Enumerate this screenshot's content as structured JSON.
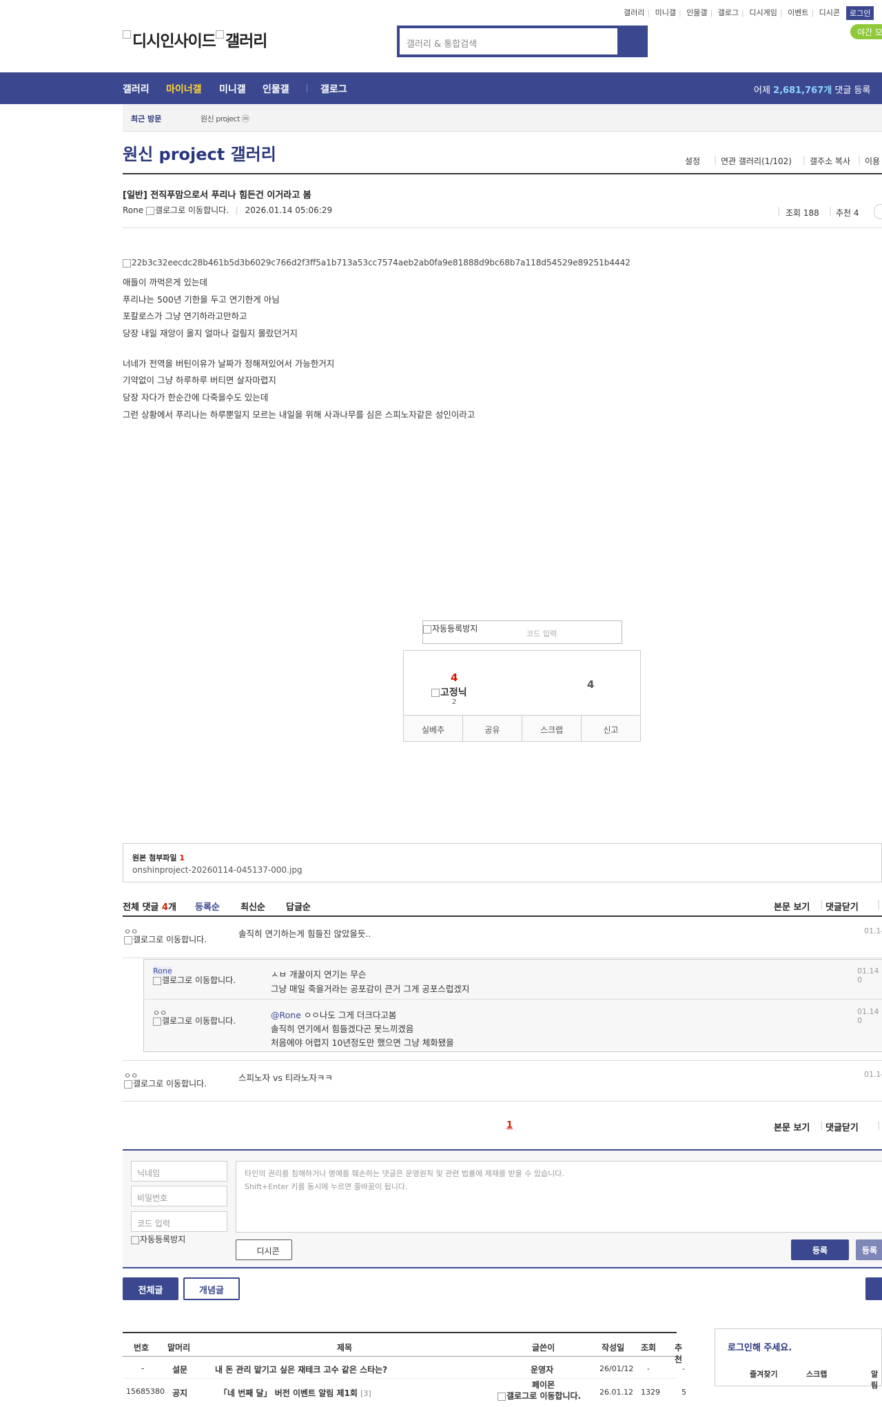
{
  "top_nav": {
    "items": [
      "갤러리",
      "미니갤",
      "인물갤",
      "갤로그",
      "디시게임",
      "이벤트",
      "디시콘"
    ],
    "login": "로그인",
    "night": "야간 모"
  },
  "header": {
    "logo_a": "디시인사이드",
    "logo_b": "갤러리",
    "search_placeholder": "갤러리 & 통합검색"
  },
  "main_nav": {
    "items": [
      "갤러리",
      "마이너갤",
      "미니갤",
      "인물갤",
      "갤로그"
    ],
    "stats_prefix": "어제",
    "stats_count": "2,681,767개",
    "stats_suffix": "댓글 등록"
  },
  "sub_nav": {
    "recent": "최근 방문",
    "gallery": "원신 project ⓜ"
  },
  "gallery": {
    "title": "원신 project 갤러리",
    "tools": [
      "설정",
      "연관 갤러리(1/102)",
      "갤주소 복사",
      "이용"
    ]
  },
  "post": {
    "title": "[일반] 전직푸맘으로서 푸리나 힘든건 이거라고 봄",
    "author": "Rone",
    "author_icon_alt": "갤로그로 이동합니다.",
    "date": "2026.01.14 05:06:29",
    "views": "조회 188",
    "recommend": "추천 4",
    "image_alt": "22b3c32eecdc28b461b5d3b6029c766d2f3ff5a1b713a53cc7574aeb2ab0fa9e81888d9bc68b7a118d54529e89251b4442",
    "lines": [
      "애들이 까먹은게 있는데",
      "푸리나는 500년 기한을 두고 연기한게 아님",
      "포칼로스가 그냥 연기하라고만하고",
      "당장 내일 재앙이 올지 얼마나 걸릴지 몰랐던거지"
    ],
    "lines2": [
      "너네가 전역을 버틴이유가 날짜가 정해져있어서 가능한거지",
      "기약없이 그냥 하루하루 버티면 살자마렵지",
      "당장 자다가 한순간에 다죽을수도 있는데",
      "그런 상황에서 푸리나는 하루뿐일지 모르는 내일을 위해 사과나무를 심은 스피노자같은 성인이라고"
    ]
  },
  "captcha": {
    "img_alt": "자동등록방지",
    "placeholder": "코드 입력"
  },
  "vote": {
    "up": "4",
    "fixed_alt": "고정닉",
    "fixed_count": "2",
    "down": "4",
    "buttons": [
      "실베추",
      "공유",
      "스크랩",
      "신고"
    ]
  },
  "attachment": {
    "label": "원본 첨부파일",
    "count": "1",
    "file": "onshinproject-20260114-045137-000.jpg"
  },
  "comments_header": {
    "all": "전체 댓글",
    "count": "4",
    "unit": "개",
    "sort": [
      "등록순",
      "최신순",
      "답글순"
    ],
    "view_body": "본문 보기",
    "close": "댓글닫기"
  },
  "comments": [
    {
      "nick": "ㅇㅇ",
      "icon": "갤로그로 이동합니다.",
      "text": "솔직히 연기하는게 힘들진 않았을듯..",
      "date": "01.14"
    },
    {
      "nick": "Rone",
      "icon": "갤로그로 이동합니다.",
      "text": "ㅅㅂ 개꿀이지 연기는 무슨",
      "text2": "그냥 매일 죽을거라는 공포감이 큰거 그게 공포스럽겠지",
      "date": "01.14 0"
    },
    {
      "nick": "ㅇㅇ",
      "icon": "갤로그로 이동합니다.",
      "mention": "@Rone",
      "text": "ㅇㅇ나도 그게 더크다고봄",
      "text2": "솔직히 연기에서 힘들겠다곤 못느끼겠음",
      "text3": "처음에야 어렵지 10년정도만 했으면 그냥 체화됐을",
      "date": "01.14 0"
    },
    {
      "nick": "ㅇㅇ",
      "icon": "갤로그로 이동합니다.",
      "text": "스피노자 vs 티라노자ㅋㅋ",
      "date": "01.14"
    }
  ],
  "pagination": {
    "current": "1"
  },
  "write": {
    "nick_ph": "닉네임",
    "pw_ph": "비밀번호",
    "code_ph": "코드 입력",
    "captcha_alt": "자동등록방지",
    "notice": "타인의 권리를 침해하거나 명예를 훼손하는 댓글은 운영원칙 및 관련 법률에 제재를 받을 수 있습니다.",
    "notice2": "Shift+Enter 키를 동시에 누르면 줄바꿈이 됩니다.",
    "dccon": "디시콘",
    "submit": "등록",
    "submit2": "등록"
  },
  "list_tabs": {
    "all": "전체글",
    "concept": "개념글"
  },
  "list": {
    "headers": [
      "번호",
      "말머리",
      "제목",
      "글쓴이",
      "작성일",
      "조회",
      "추천"
    ],
    "rows": [
      {
        "no": "-",
        "head": "설문",
        "title": "내 돈 관리 맡기고 싶은 재테크 고수 같은 스타는?",
        "writer": "운영자",
        "date": "26/01/12",
        "views": "-",
        "rec": "-"
      },
      {
        "no": "15685380",
        "head": "공지",
        "title": "「네 번째 달」 버전 이벤트 알림 제1회",
        "reply": "[3]",
        "writer": "페이몬",
        "writer_icon": "갤로그로 이동합니다.",
        "date": "26.01.12",
        "views": "1329",
        "rec": "5"
      }
    ]
  },
  "login_box": {
    "title": "로그인해 주세요.",
    "items": [
      "즐겨찾기",
      "스크랩",
      "알림"
    ]
  }
}
